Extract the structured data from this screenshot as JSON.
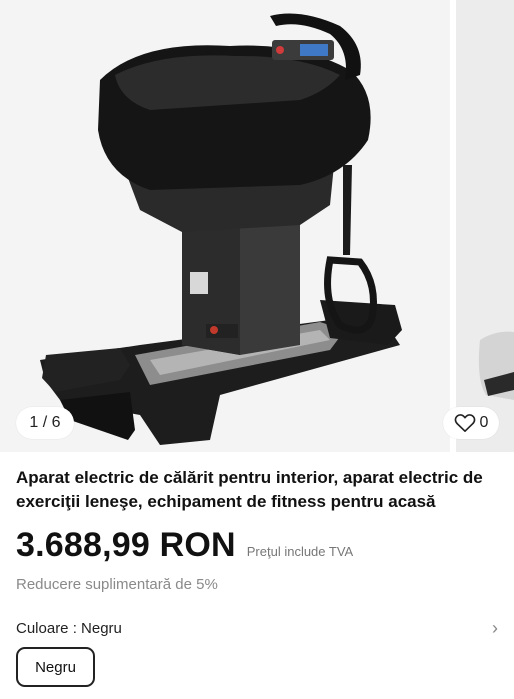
{
  "gallery": {
    "counter": "1 / 6",
    "favorites_count": "0"
  },
  "product": {
    "title": "Aparat electric de călărit pentru interior, aparat electric de exerciţii leneşe, echipament de fitness pentru acasă",
    "price": "3.688,99 RON",
    "vat_note": "Preţul include TVA",
    "discount_note": "Reducere suplimentară de 5%"
  },
  "variant": {
    "label": "Culoare : Negru",
    "selected_option": "Negru"
  },
  "icons": {
    "favorite": "heart-icon",
    "expand": "chevron-right-icon"
  }
}
